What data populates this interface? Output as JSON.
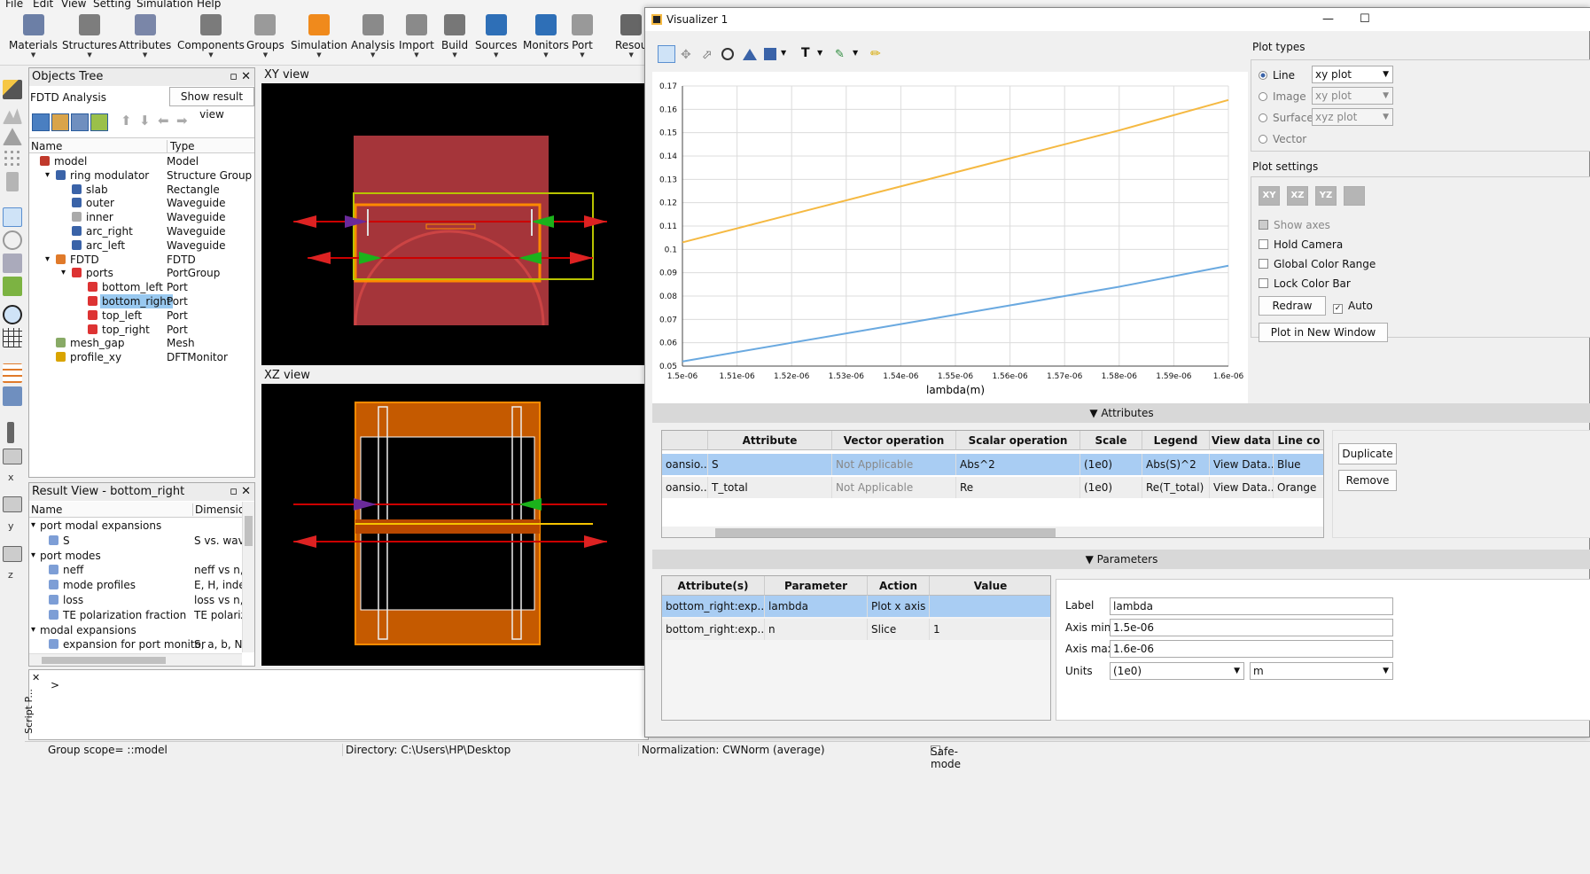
{
  "menu": [
    "File",
    "Edit",
    "View",
    "Setting",
    "Simulation",
    "Help"
  ],
  "toolbar": [
    {
      "label": "Materials",
      "icon": "materials-icon",
      "color": "#6c7fa6"
    },
    {
      "label": "Structures",
      "icon": "structures-icon",
      "color": "#7d7d7d"
    },
    {
      "label": "Attributes",
      "icon": "attributes-icon",
      "color": "#7a86a8"
    },
    {
      "label": "Components",
      "icon": "components-icon",
      "color": "#7b7b7b"
    },
    {
      "label": "Groups",
      "icon": "groups-icon",
      "color": "#9a9a9a"
    },
    {
      "label": "Simulation",
      "icon": "simulation-icon",
      "color": "#f08a1c"
    },
    {
      "label": "Analysis",
      "icon": "analysis-icon",
      "color": "#8a8a8a"
    },
    {
      "label": "Import",
      "icon": "import-icon",
      "color": "#8a8a8a"
    },
    {
      "label": "Build",
      "icon": "build-icon",
      "color": "#777"
    },
    {
      "label": "Sources",
      "icon": "sources-icon",
      "color": "#2e6fb7"
    },
    {
      "label": "Monitors",
      "icon": "monitors-icon",
      "color": "#2e6fb7"
    },
    {
      "label": "Port",
      "icon": "port-icon",
      "color": "#999"
    },
    {
      "label": "Resou",
      "icon": "resources-icon",
      "color": "#666"
    }
  ],
  "objects_tree": {
    "title": "Objects Tree",
    "analysis_label": "FDTD Analysis",
    "show_result_button": "Show result view",
    "col_name": "Name",
    "col_type": "Type",
    "rows": [
      {
        "name": "model",
        "type": "Model",
        "indent": 0,
        "exp": "",
        "color": "#c0392b"
      },
      {
        "name": "ring modulator",
        "type": "Structure Group",
        "indent": 1,
        "exp": "▾",
        "color": "#3a63a8"
      },
      {
        "name": "slab",
        "type": "Rectangle",
        "indent": 2,
        "exp": "",
        "color": "#3a63a8"
      },
      {
        "name": "outer",
        "type": "Waveguide",
        "indent": 2,
        "exp": "",
        "color": "#3a63a8"
      },
      {
        "name": "inner",
        "type": "Waveguide",
        "indent": 2,
        "exp": "",
        "color": "#aaaaaa"
      },
      {
        "name": "arc_right",
        "type": "Waveguide",
        "indent": 2,
        "exp": "",
        "color": "#3a63a8"
      },
      {
        "name": "arc_left",
        "type": "Waveguide",
        "indent": 2,
        "exp": "",
        "color": "#3a63a8"
      },
      {
        "name": "FDTD",
        "type": "FDTD",
        "indent": 1,
        "exp": "▾",
        "color": "#e07a2a"
      },
      {
        "name": "ports",
        "type": "PortGroup",
        "indent": 2,
        "exp": "▾",
        "color": "#d33"
      },
      {
        "name": "bottom_left",
        "type": "Port",
        "indent": 3,
        "exp": "",
        "color": "#d33"
      },
      {
        "name": "bottom_right",
        "type": "Port",
        "indent": 3,
        "exp": "",
        "color": "#d33",
        "sel": true
      },
      {
        "name": "top_left",
        "type": "Port",
        "indent": 3,
        "exp": "",
        "color": "#d33"
      },
      {
        "name": "top_right",
        "type": "Port",
        "indent": 3,
        "exp": "",
        "color": "#d33"
      },
      {
        "name": "mesh_gap",
        "type": "Mesh",
        "indent": 1,
        "exp": "",
        "color": "#8a6"
      },
      {
        "name": "profile_xy",
        "type": "DFTMonitor",
        "indent": 1,
        "exp": "",
        "color": "#d9a400"
      }
    ]
  },
  "result_view": {
    "title": "Result View - bottom_right",
    "col_name": "Name",
    "col_dim": "Dimension",
    "rows": [
      {
        "name": "port modal expansions",
        "dim": "",
        "indent": 0,
        "exp": "▾"
      },
      {
        "name": "S",
        "dim": "S vs. wave",
        "indent": 1,
        "exp": ""
      },
      {
        "name": "port modes",
        "dim": "",
        "indent": 0,
        "exp": "▾"
      },
      {
        "name": "neff",
        "dim": "neff vs n, w",
        "indent": 1,
        "exp": ""
      },
      {
        "name": "mode profiles",
        "dim": "E, H, index",
        "indent": 1,
        "exp": ""
      },
      {
        "name": "loss",
        "dim": "loss vs n, w",
        "indent": 1,
        "exp": ""
      },
      {
        "name": "TE polarization fraction",
        "dim": "TE polariz",
        "indent": 1,
        "exp": ""
      },
      {
        "name": "modal expansions",
        "dim": "",
        "indent": 0,
        "exp": "▾"
      },
      {
        "name": "expansion for port monitor",
        "dim": "S, a, b, N, F",
        "indent": 1,
        "exp": ""
      }
    ]
  },
  "xy_view_label": "XY view",
  "xz_view_label": "XZ view",
  "script_prompt": ">",
  "script_label": "Script P...",
  "left_axes": {
    "x": "x",
    "y": "y",
    "z": "z"
  },
  "visualizer": {
    "title": "Visualizer 1",
    "plot_types_label": "Plot types",
    "plot_types": [
      {
        "label": "Line",
        "value": "xy plot",
        "selected": true
      },
      {
        "label": "Image",
        "value": "xy plot",
        "selected": false
      },
      {
        "label": "Surface",
        "value": "xyz plot",
        "selected": false
      },
      {
        "label": "Vector",
        "value": "",
        "selected": false
      }
    ],
    "plot_settings_label": "Plot settings",
    "view_buttons": [
      "XY",
      "XZ",
      "YZ"
    ],
    "settings": [
      {
        "label": "Show axes",
        "checked": true,
        "disabled": true
      },
      {
        "label": "Hold Camera",
        "checked": false
      },
      {
        "label": "Global Color Range",
        "checked": false
      },
      {
        "label": "Lock Color Bar",
        "checked": false
      }
    ],
    "redraw_button": "Redraw",
    "auto_label": "Auto",
    "plot_new_window_button": "Plot in New Window",
    "attributes_header": "Attributes",
    "attr_columns": [
      "",
      "Attribute",
      "Vector operation",
      "Scalar operation",
      "Scale",
      "Legend",
      "View data",
      "Line co"
    ],
    "attr_rows": [
      {
        "c0": "oansio...",
        "attr": "S",
        "vec": "Not Applicable",
        "scalar": "Abs^2",
        "scale": "(1e0)",
        "legend": "Abs(S)^2",
        "view": "View Data...",
        "line": "Blue"
      },
      {
        "c0": "oansio...",
        "attr": "T_total",
        "vec": "Not Applicable",
        "scalar": "Re",
        "scale": "(1e0)",
        "legend": "Re(T_total)",
        "view": "View Data...",
        "line": "Orange"
      }
    ],
    "duplicate_button": "Duplicate",
    "remove_button": "Remove",
    "parameters_header": "Parameters",
    "param_columns": [
      "Attribute(s)",
      "Parameter",
      "Action",
      "Value"
    ],
    "param_rows": [
      {
        "attr": "bottom_right:exp...",
        "param": "lambda",
        "action": "Plot x axis",
        "value": ""
      },
      {
        "attr": "bottom_right:exp...",
        "param": "n",
        "action": "Slice",
        "value": "1"
      }
    ],
    "label_field": {
      "label": "Label",
      "value": "lambda"
    },
    "axis_min": {
      "label": "Axis min",
      "value": "1.5e-06"
    },
    "axis_max": {
      "label": "Axis max",
      "value": "1.6e-06"
    },
    "units": {
      "label": "Units",
      "scale": "(1e0)",
      "unit": "m"
    }
  },
  "chart_data": {
    "type": "line",
    "xlabel": "lambda(m)",
    "ylabel": "",
    "xlim": [
      1.5e-06,
      1.6e-06
    ],
    "ylim": [
      0.05,
      0.17
    ],
    "x_ticks": [
      "1.5e-06",
      "1.51e-06",
      "1.52e-06",
      "1.53e-06",
      "1.54e-06",
      "1.55e-06",
      "1.56e-06",
      "1.57e-06",
      "1.58e-06",
      "1.59e-06",
      "1.6e-06"
    ],
    "y_ticks": [
      "0.05",
      "0.06",
      "0.07",
      "0.08",
      "0.09",
      "0.1",
      "0.11",
      "0.12",
      "0.13",
      "0.14",
      "0.15",
      "0.16",
      "0.17"
    ],
    "grid": true,
    "series": [
      {
        "color": "#f5b942",
        "x": [
          1.5e-06,
          1.52e-06,
          1.54e-06,
          1.56e-06,
          1.58e-06,
          1.6e-06
        ],
        "values": [
          0.103,
          0.115,
          0.127,
          0.139,
          0.151,
          0.164
        ]
      },
      {
        "color": "#6aa9e0",
        "x": [
          1.5e-06,
          1.52e-06,
          1.54e-06,
          1.56e-06,
          1.58e-06,
          1.6e-06
        ],
        "values": [
          0.052,
          0.06,
          0.068,
          0.076,
          0.084,
          0.093
        ]
      }
    ]
  },
  "status": {
    "scope": "Group scope= ::model",
    "directory": "Directory: C:\\Users\\HP\\Desktop",
    "normalization": "Normalization: CWNorm (average)",
    "safe_mode": "Safe-mode"
  }
}
